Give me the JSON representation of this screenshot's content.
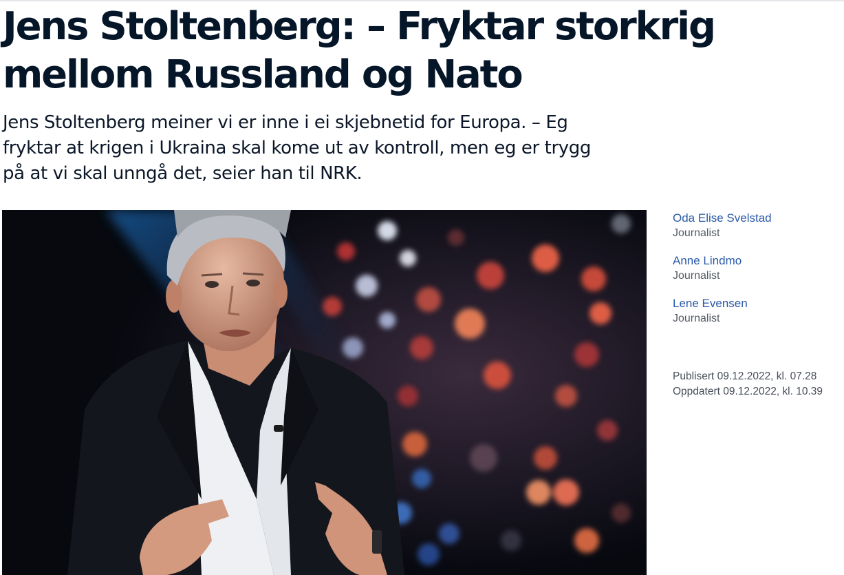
{
  "article": {
    "headline": "Jens Stoltenberg: – Fryktar storkrig mellom Russland og Nato",
    "lead": "Jens Stoltenberg meiner vi er inne i ei skjebnetid for Europa. – Eg fryktar at krigen i Ukraina skal kome ut av kontroll, men eg er trygg på at vi skal unngå det, seier han til NRK."
  },
  "authors": [
    {
      "name": "Oda Elise Svelstad",
      "role": "Journalist"
    },
    {
      "name": "Anne Lindmo",
      "role": "Journalist"
    },
    {
      "name": "Lene Evensen",
      "role": "Journalist"
    }
  ],
  "dates": {
    "published": "Publisert 09.12.2022, kl. 07.28",
    "updated": "Oppdatert 09.12.2022, kl. 10.39"
  },
  "colors": {
    "headline": "#061629",
    "author_link": "#2a59a8",
    "meta_text": "#474e58"
  }
}
